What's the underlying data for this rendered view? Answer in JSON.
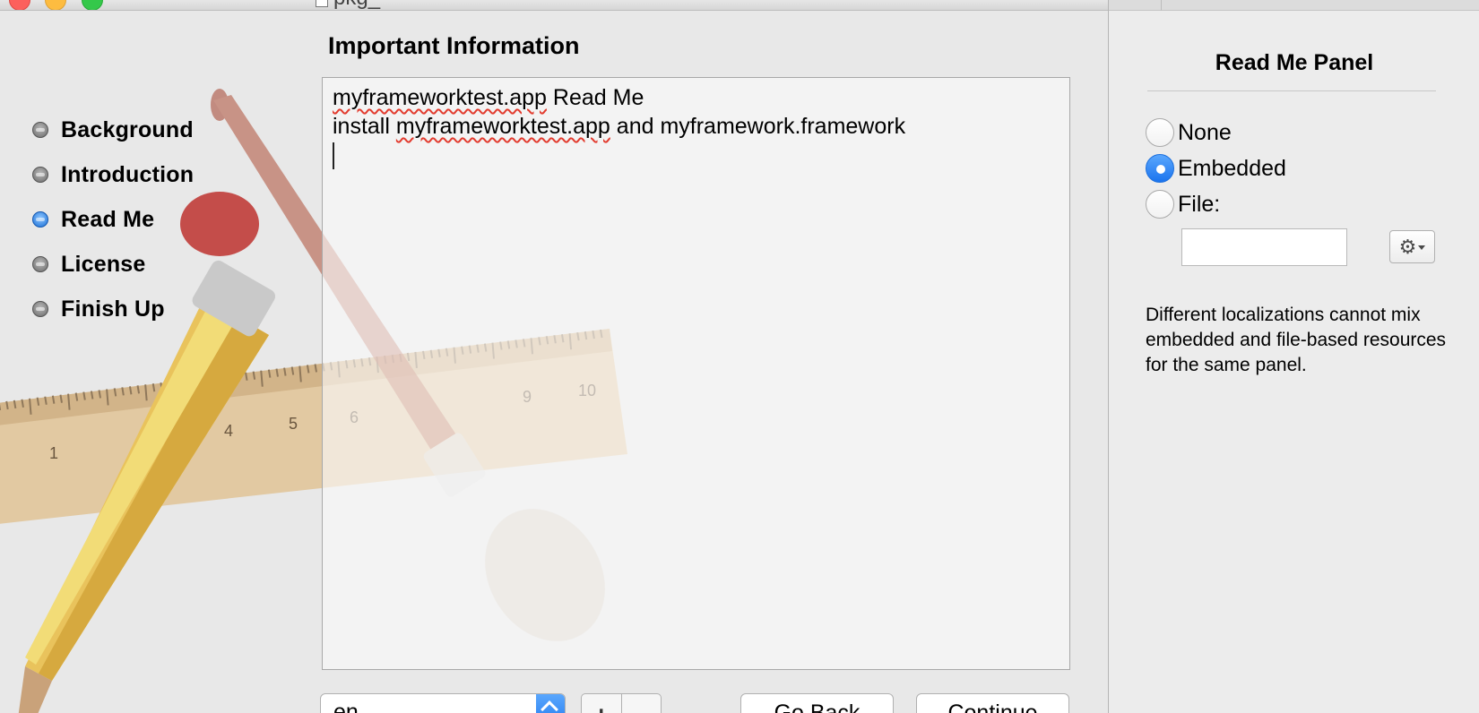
{
  "window": {
    "title": "pkg_"
  },
  "steps": {
    "items": [
      {
        "label": "Background"
      },
      {
        "label": "Introduction"
      },
      {
        "label": "Read Me"
      },
      {
        "label": "License"
      },
      {
        "label": "Finish Up"
      }
    ],
    "active": "Read Me"
  },
  "content": {
    "title": "Important Information",
    "readme": {
      "line1_app": "myframeworktest.app",
      "line1_rest": " Read Me",
      "line2_prefix": "install ",
      "line2_app": "myframeworktest.app",
      "line2_rest": " and myframework.framework"
    }
  },
  "bottom": {
    "language": "en",
    "add_label": "+",
    "remove_label": "−",
    "go_back_label": "Go Back",
    "continue_label": "Continue"
  },
  "inspector": {
    "title": "Read Me Panel",
    "options": [
      {
        "label": "None",
        "checked": false
      },
      {
        "label": "Embedded",
        "checked": true
      },
      {
        "label": "File:",
        "checked": false
      }
    ],
    "file_path": "",
    "note": "Different localizations cannot mix embedded and file-based resources for the same panel."
  },
  "icons": {
    "gear": "gear-icon",
    "chevron": "chevron-up-down-icon"
  },
  "colors": {
    "accent": "#1b74ee",
    "spell_underline": "#e23b2e"
  }
}
